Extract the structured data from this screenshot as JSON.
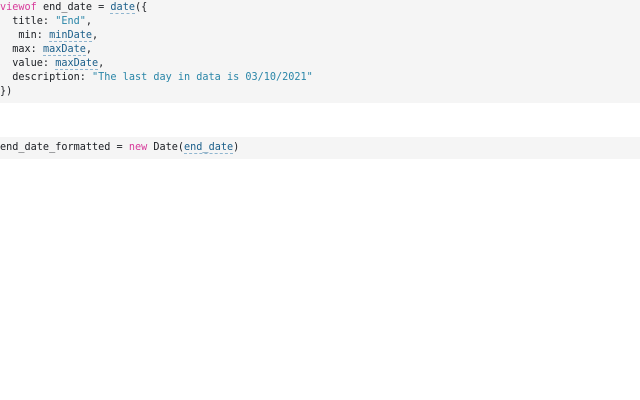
{
  "cells": [
    {
      "lines": [
        {
          "tokens": [
            {
              "t": "viewof",
              "k": "kw"
            },
            {
              "t": " end_date = ",
              "k": "plain"
            },
            {
              "t": "date",
              "k": "ref"
            },
            {
              "t": "({",
              "k": "plain"
            }
          ]
        },
        {
          "tokens": [
            {
              "t": "  title: ",
              "k": "plain"
            },
            {
              "t": "\"End\"",
              "k": "str"
            },
            {
              "t": ",",
              "k": "plain"
            }
          ]
        },
        {
          "tokens": [
            {
              "t": "   min: ",
              "k": "plain"
            },
            {
              "t": "minDate",
              "k": "ref"
            },
            {
              "t": ",",
              "k": "plain"
            }
          ]
        },
        {
          "tokens": [
            {
              "t": "  max: ",
              "k": "plain"
            },
            {
              "t": "maxDate",
              "k": "ref"
            },
            {
              "t": ",",
              "k": "plain"
            }
          ]
        },
        {
          "tokens": [
            {
              "t": "  value: ",
              "k": "plain"
            },
            {
              "t": "maxDate",
              "k": "ref"
            },
            {
              "t": ",",
              "k": "plain"
            }
          ]
        },
        {
          "tokens": [
            {
              "t": "  description: ",
              "k": "plain"
            },
            {
              "t": "\"The last day in data is 03/10/2021\"",
              "k": "str"
            }
          ]
        },
        {
          "tokens": [
            {
              "t": "})",
              "k": "plain"
            }
          ]
        }
      ]
    },
    {
      "lines": [
        {
          "tokens": [
            {
              "t": "end_date_formatted = ",
              "k": "plain"
            },
            {
              "t": "new",
              "k": "kw"
            },
            {
              "t": " Date(",
              "k": "plain"
            },
            {
              "t": "end_date",
              "k": "ref"
            },
            {
              "t": ")",
              "k": "plain"
            }
          ]
        }
      ]
    }
  ]
}
